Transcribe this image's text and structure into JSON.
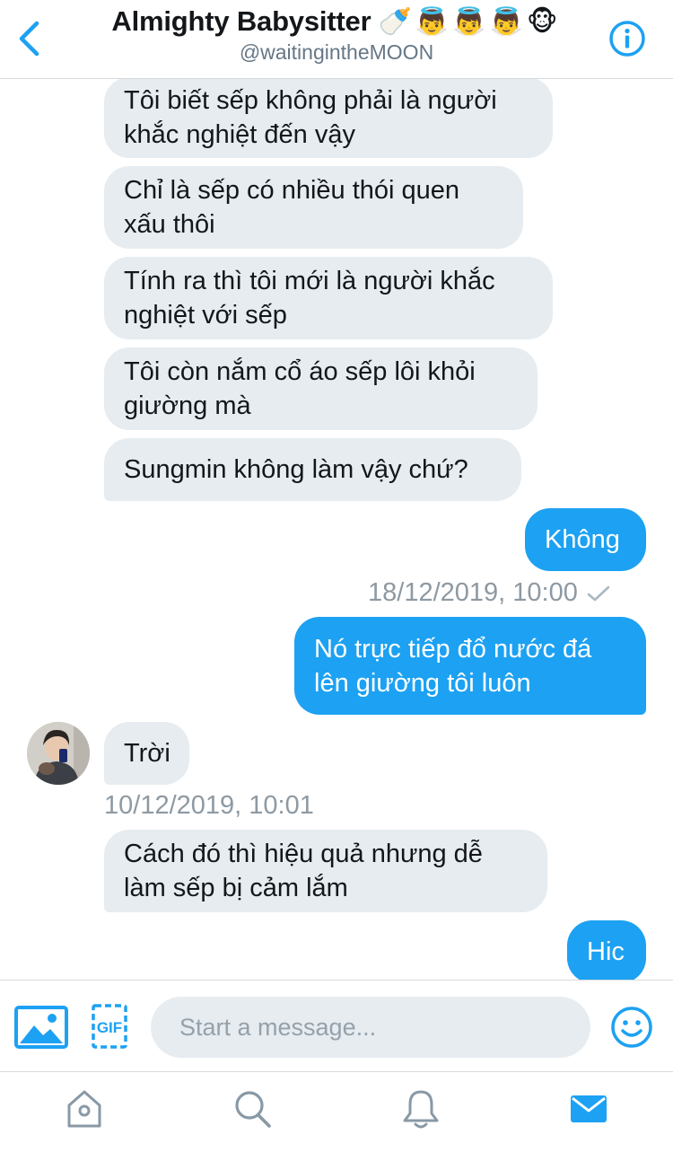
{
  "header": {
    "title": "Almighty Babysitter",
    "title_emojis": "🍼👼👼👼🐵",
    "handle": "@waitingintheMOON"
  },
  "messages": [
    {
      "side": "in",
      "text": "Tôi biết sếp không phải là người khắc nghiệt đến vậy"
    },
    {
      "side": "in",
      "text": "Chỉ là sếp có nhiều thói quen xấu thôi"
    },
    {
      "side": "in",
      "text": "Tính ra thì tôi mới là người khắc nghiệt với sếp"
    },
    {
      "side": "in",
      "text": "Tôi còn nắm cổ áo sếp lôi khỏi giường mà"
    },
    {
      "side": "in",
      "text": "Sungmin không làm vậy chứ?"
    },
    {
      "side": "out",
      "text": "Không"
    },
    {
      "side": "out",
      "text": "Nó trực tiếp đổ nước đá lên giường tôi luôn"
    },
    {
      "side": "in",
      "text": "Trời"
    },
    {
      "side": "in",
      "text": "Cách đó thì hiệu quả nhưng dễ làm sếp bị cảm lắm"
    },
    {
      "side": "out",
      "text": "Hic"
    }
  ],
  "timestamps": {
    "sent": "18/12/2019, 10:00",
    "received": "10/12/2019, 10:01"
  },
  "composer": {
    "placeholder": "Start a message...",
    "gif_label": "GIF"
  },
  "colors": {
    "accent": "#1da1f2",
    "incoming_bubble": "#e6ecf0",
    "timestamp": "#8e99a2"
  },
  "tabs": [
    {
      "name": "home",
      "icon": "home-icon",
      "active": false
    },
    {
      "name": "search",
      "icon": "search-icon",
      "active": false
    },
    {
      "name": "notifications",
      "icon": "bell-icon",
      "active": false
    },
    {
      "name": "messages",
      "icon": "mail-icon",
      "active": true
    }
  ]
}
